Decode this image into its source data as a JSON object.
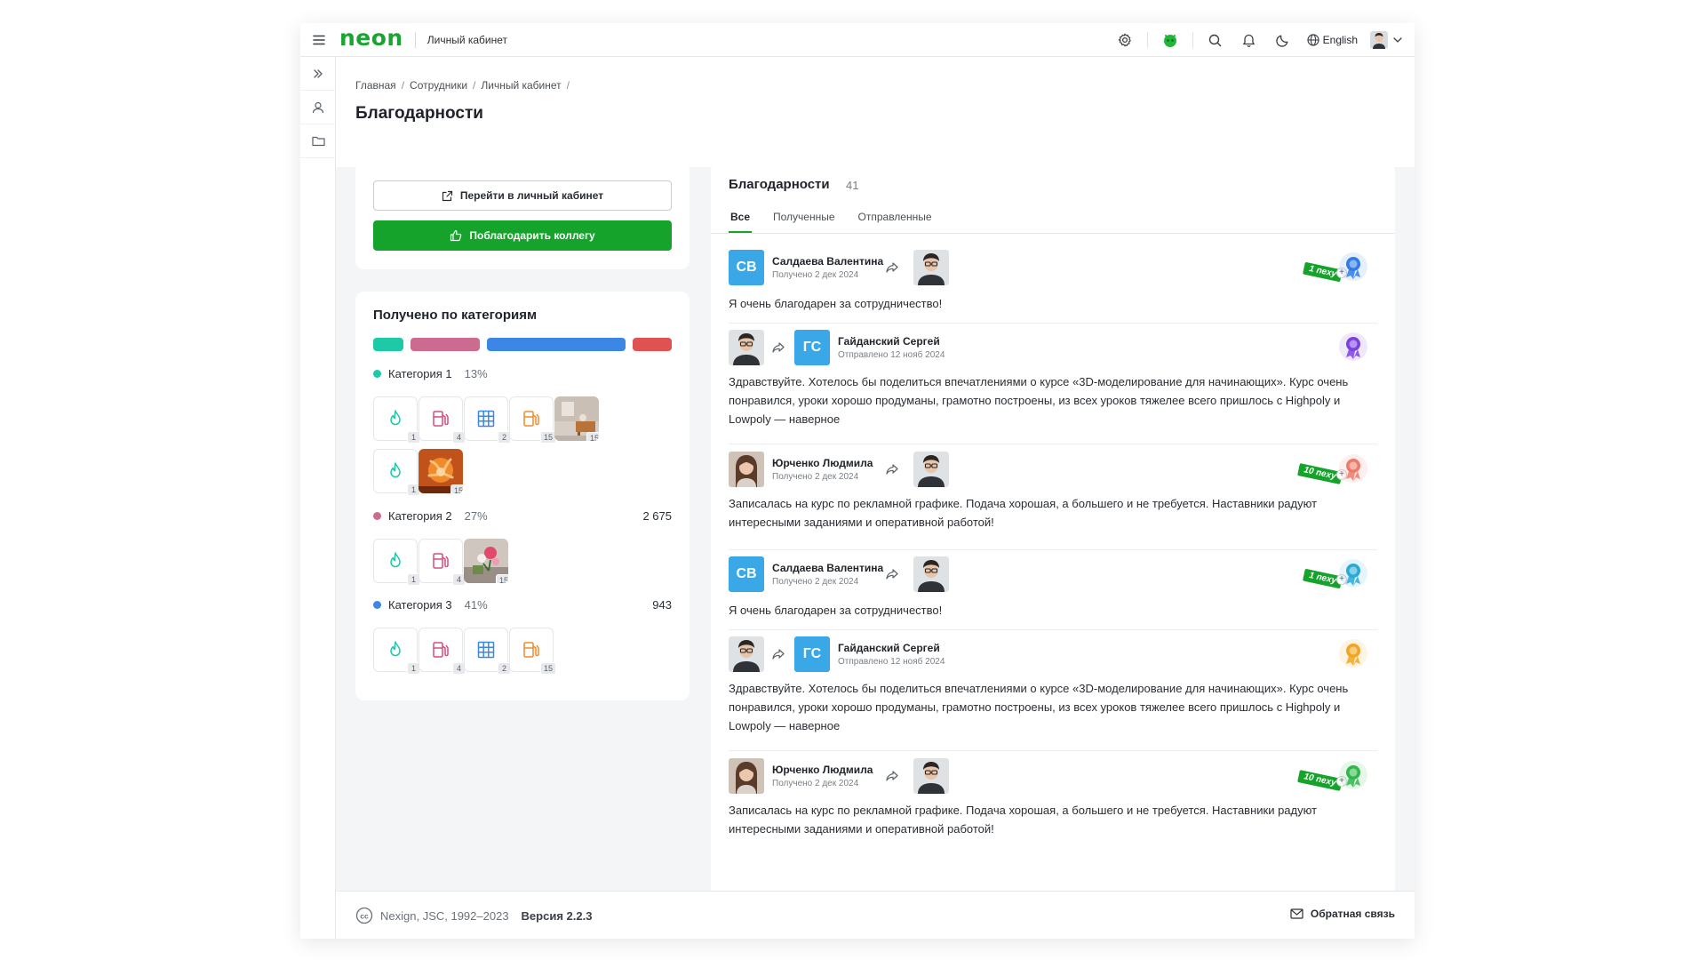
{
  "header": {
    "logo": "neon",
    "title": "Личный кабинет",
    "language": "English",
    "icons": [
      "menu-icon",
      "gear-icon",
      "app-icon",
      "search-icon",
      "bell-icon",
      "moon-icon",
      "globe-icon",
      "chevron-down-icon"
    ]
  },
  "rail": {
    "icons": [
      "double-chevron-right-icon",
      "user-icon",
      "folder-icon"
    ]
  },
  "breadcrumb": [
    "Главная",
    "Сотрудники",
    "Личный кабинет"
  ],
  "page_title": "Благодарности",
  "actions": {
    "profile_button": "Перейти в личный кабинет",
    "thank_button": "Поблагодарить коллегу"
  },
  "categories_card": {
    "title": "Получено по категориям",
    "bar_colors": [
      "#1ec9a7",
      "#cc6b8f",
      "#3c86e5",
      "#e05252"
    ],
    "items": [
      {
        "name": "Категория 1",
        "percent": "13%",
        "total": "",
        "dot_color": "#1ec9a7",
        "tiles": [
          {
            "icon": "flame-icon",
            "count": "1"
          },
          {
            "icon": "fuel-icon",
            "count": "4"
          },
          {
            "icon": "grid-icon",
            "count": "2"
          },
          {
            "icon": "fuel-icon",
            "count": "15"
          },
          {
            "icon": "photo-room",
            "count": "15"
          },
          {
            "icon": "flame-icon",
            "count": "1"
          },
          {
            "icon": "photo-flower",
            "count": "15"
          }
        ]
      },
      {
        "name": "Категория 2",
        "percent": "27%",
        "total": "2 675",
        "dot_color": "#cc6b8f",
        "tiles": [
          {
            "icon": "flame-icon",
            "count": "1"
          },
          {
            "icon": "fuel-icon",
            "count": "4"
          },
          {
            "icon": "photo-flowers",
            "count": "15"
          }
        ]
      },
      {
        "name": "Категория 3",
        "percent": "41%",
        "total": "943",
        "dot_color": "#3c86e5",
        "tiles": [
          {
            "icon": "flame-icon",
            "count": "1"
          },
          {
            "icon": "fuel-icon",
            "count": "4"
          },
          {
            "icon": "grid-icon",
            "count": "2"
          },
          {
            "icon": "fuel-icon",
            "count": "15"
          }
        ]
      }
    ]
  },
  "feed": {
    "title": "Благодарности",
    "count": "41",
    "tabs": [
      "Все",
      "Полученные",
      "Отправленные"
    ],
    "items": [
      {
        "direction": "received",
        "name": "Салдаева Валентина",
        "initials": "СВ",
        "date": "Получено 2 дек 2024",
        "text": "Я очень благодарен за сотрудничество!",
        "ribbon": "1 nexy",
        "medal_color": "#2f7bea"
      },
      {
        "direction": "sent",
        "name": "Гайданский Сергей",
        "initials": "ГС",
        "date": "Отправлено 12 нояб 2024",
        "text": "Здравствуйте. Хотелось бы поделиться впечатлениями о курсе «3D-моделирование для начинающих». Курс очень понравился, уроки хорошо продуманы, грамотно построены, из всех уроков тяжелее всего пришлось с Highpoly и Lowpoly — наверное",
        "ribbon": "",
        "medal_color": "#7b3fe4"
      },
      {
        "direction": "received",
        "name": "Юрченко Людмила",
        "initials": "",
        "date": "Получено 2 дек 2024",
        "text": "Записалась на курс по рекламной графике. Подача хорошая, а большего и не требуется. Наставники радуют интересными заданиями и оперативной работой!",
        "ribbon": "10 nexy",
        "medal_color": "#f07a6a"
      },
      {
        "direction": "received",
        "name": "Салдаева Валентина",
        "initials": "СВ",
        "date": "Получено 2 дек 2024",
        "text": "Я очень благодарен за сотрудничество!",
        "ribbon": "1 nexy",
        "medal_color": "#29a9d6"
      },
      {
        "direction": "sent",
        "name": "Гайданский Сергей",
        "initials": "ГС",
        "date": "Отправлено 12 нояб 2024",
        "text": "Здравствуйте. Хотелось бы поделиться впечатлениями о курсе «3D-моделирование для начинающих». Курс очень понравился, уроки хорошо продуманы, грамотно построены, из всех уроков тяжелее всего пришлось с Highpoly и Lowpoly — наверное",
        "ribbon": "",
        "medal_color": "#f2a51e"
      },
      {
        "direction": "received",
        "name": "Юрченко Людмила",
        "initials": "",
        "date": "Получено 2 дек 2024",
        "text": "Записалась на курс по рекламной графике. Подача хорошая, а большего и не требуется. Наставники радуют интересными заданиями и оперативной работой!",
        "ribbon": "10 nexy",
        "medal_color": "#2fb84a"
      }
    ]
  },
  "footer": {
    "copyright": "Nexign, JSC, 1992–2023",
    "version": "Версия 2.2.3",
    "feedback": "Обратная связь"
  }
}
